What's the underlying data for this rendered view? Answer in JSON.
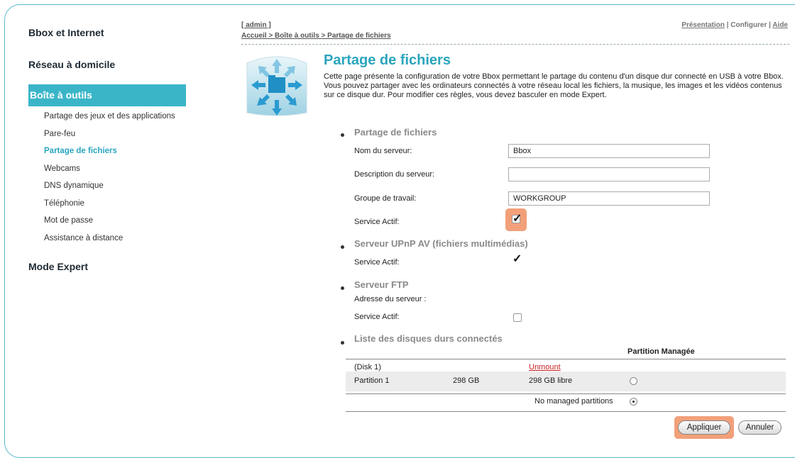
{
  "sidebar": {
    "h1": "Bbox et Internet",
    "h2": "Réseau à domicile",
    "active": "Boîte à outils",
    "items": [
      {
        "label": "Partage des jeux et des applications"
      },
      {
        "label": "Pare-feu"
      },
      {
        "label": "Partage de fichiers"
      },
      {
        "label": "Webcams"
      },
      {
        "label": "DNS dynamique"
      },
      {
        "label": "Téléphonie"
      },
      {
        "label": "Mot de passe"
      },
      {
        "label": "Assistance à distance"
      }
    ],
    "h3": "Mode Expert"
  },
  "top": {
    "user": "[ admin ]",
    "crumb": "Accueil > Boîte à outils > Partage de fichiers",
    "presentation": "Présentation",
    "sep1": " | ",
    "configurer": "Configurer",
    "sep2": " | ",
    "aide": "Aide"
  },
  "main": {
    "title": "Partage de fichiers",
    "intro": "Cette page présente la configuration de votre Bbox permettant le partage du contenu d'un disque dur connecté en USB à votre Bbox.  Vous pouvez partager avec les ordinateurs connectés à votre réseau local les fichiers, la musique, les images et les vidéos contenus sur ce disque dur.  Pour modifier ces règles, vous devez basculer en mode Expert.",
    "sec1": {
      "title": "Partage de fichiers",
      "server_name_label": "Nom du serveur:",
      "server_name": "Bbox",
      "server_desc_label": "Description du serveur:",
      "server_desc": "",
      "workgroup_label": "Groupe de travail:",
      "workgroup": "WORKGROUP",
      "service_label": "Service Actif:"
    },
    "sec2": {
      "title": "Serveur UPnP AV (fichiers multimédias)",
      "service_label": "Service Actif:"
    },
    "sec3": {
      "title": "Serveur FTP",
      "address_label": "Adresse du serveur :",
      "service_label": "Service Actif:"
    },
    "sec4": {
      "title": "Liste des disques durs connectés",
      "col_partition": "Partition Managée",
      "disk": "(Disk 1)",
      "unmount": "Unmount",
      "partition": "Partition 1",
      "size": "298 GB",
      "free": "298 GB libre",
      "no_managed": "No managed partitions"
    },
    "apply": "Appliquer",
    "cancel": "Annuler"
  },
  "colors": {
    "accent": "#3ab5c8",
    "highlight": "#f2a07a",
    "unmount": "#cc2222"
  }
}
